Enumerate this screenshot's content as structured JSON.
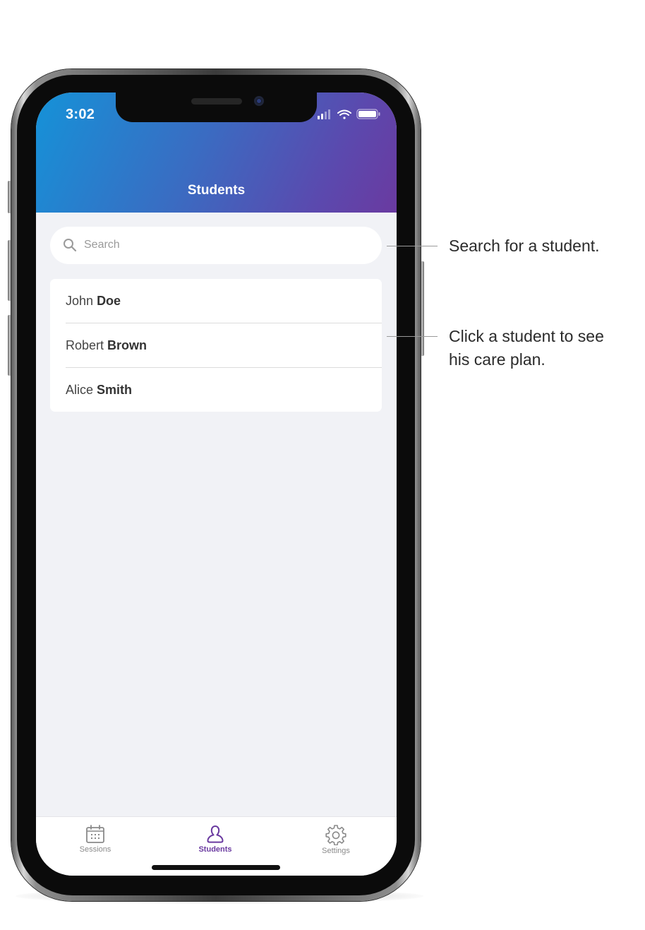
{
  "status_bar": {
    "time": "3:02"
  },
  "header": {
    "title": "Students"
  },
  "search": {
    "placeholder": "Search"
  },
  "students": [
    {
      "first": "John",
      "last": "Doe"
    },
    {
      "first": "Robert",
      "last": "Brown"
    },
    {
      "first": "Alice",
      "last": "Smith"
    }
  ],
  "tabs": [
    {
      "label": "Sessions",
      "icon": "calendar-icon",
      "active": false
    },
    {
      "label": "Students",
      "icon": "person-icon",
      "active": true
    },
    {
      "label": "Settings",
      "icon": "gear-icon",
      "active": false
    }
  ],
  "annotations": {
    "search_tip": "Search for a student.",
    "list_tip_line1": "Click a student to see",
    "list_tip_line2": "his care plan."
  },
  "colors": {
    "header_gradient_start": "#1592d8",
    "header_gradient_end": "#6a3aa0",
    "active_tab": "#6a3aa0",
    "background": "#f1f2f6"
  }
}
